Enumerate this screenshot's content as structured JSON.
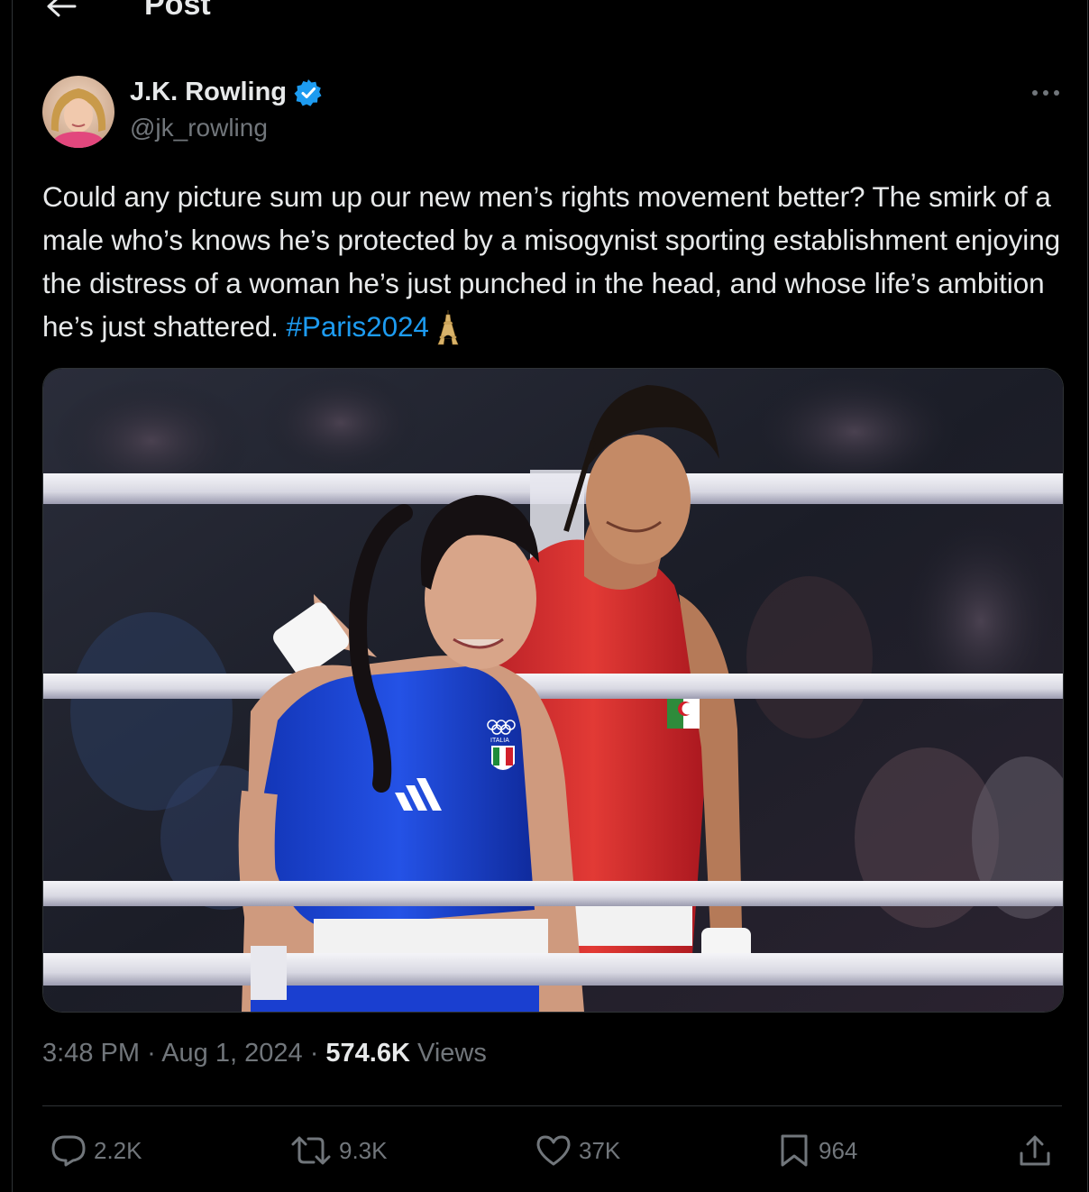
{
  "header": {
    "back_icon": "arrow-left-icon",
    "title": "Post"
  },
  "author": {
    "display_name": "J.K. Rowling",
    "handle": "@jk_rowling",
    "verified_icon": "verified-badge-icon",
    "verified_color": "#1d9bf0"
  },
  "more_icon": "more-horizontal-icon",
  "tweet": {
    "text_before_hashtag": "Could any picture sum up our new men’s rights movement better? The smirk of a male who’s knows he’s protected by a misogynist sporting establishment enjoying the distress of a woman he’s just punched in the head, and whose life’s ambition he’s just shattered. ",
    "hashtag": "#Paris2024",
    "emoji": "eiffel-tower-icon",
    "hashtag_color": "#1d9bf0"
  },
  "media": {
    "kind": "photo",
    "vest_text": "ITALIA"
  },
  "meta": {
    "time": "3:48 PM",
    "separator": "·",
    "date": "Aug 1, 2024",
    "views_count": "574.6K",
    "views_label": "Views"
  },
  "actions": {
    "reply": {
      "icon": "reply-icon",
      "count": "2.2K"
    },
    "repost": {
      "icon": "repost-icon",
      "count": "9.3K"
    },
    "like": {
      "icon": "heart-icon",
      "count": "37K"
    },
    "bookmark": {
      "icon": "bookmark-icon",
      "count": "964"
    },
    "share": {
      "icon": "share-icon"
    }
  },
  "colors": {
    "background": "#000000",
    "text_primary": "#e7e9ea",
    "text_secondary": "#71767b",
    "border": "#2f3336",
    "accent": "#1d9bf0"
  }
}
